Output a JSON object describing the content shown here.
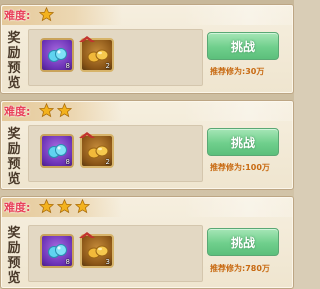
{
  "stages": [
    {
      "difficulty_label": "难度:",
      "stars": 1,
      "reward_label": "奖励预览",
      "items": [
        {
          "icon": "blue-gem-icon",
          "count": "8",
          "rarity": "purple"
        },
        {
          "icon": "gold-pouch-icon",
          "count": "2",
          "rarity": "orange"
        }
      ],
      "button_label": "挑战",
      "power_text": "推荐修为:30万"
    },
    {
      "difficulty_label": "难度:",
      "stars": 2,
      "reward_label": "奖励预览",
      "items": [
        {
          "icon": "blue-gem-icon",
          "count": "8",
          "rarity": "purple"
        },
        {
          "icon": "gold-pouch-icon",
          "count": "2",
          "rarity": "orange"
        }
      ],
      "button_label": "挑战",
      "power_text": "推荐修为:100万"
    },
    {
      "difficulty_label": "难度:",
      "stars": 3,
      "reward_label": "奖励预览",
      "items": [
        {
          "icon": "blue-gem-icon",
          "count": "8",
          "rarity": "purple"
        },
        {
          "icon": "gold-pouch-icon",
          "count": "3",
          "rarity": "orange"
        }
      ],
      "button_label": "挑战",
      "power_text": "推荐修为:780万"
    }
  ],
  "colors": {
    "difficulty_text": "#e8425a",
    "power_text": "#c86a12",
    "button": "#6fcf8c",
    "star": "#f3b21e"
  }
}
